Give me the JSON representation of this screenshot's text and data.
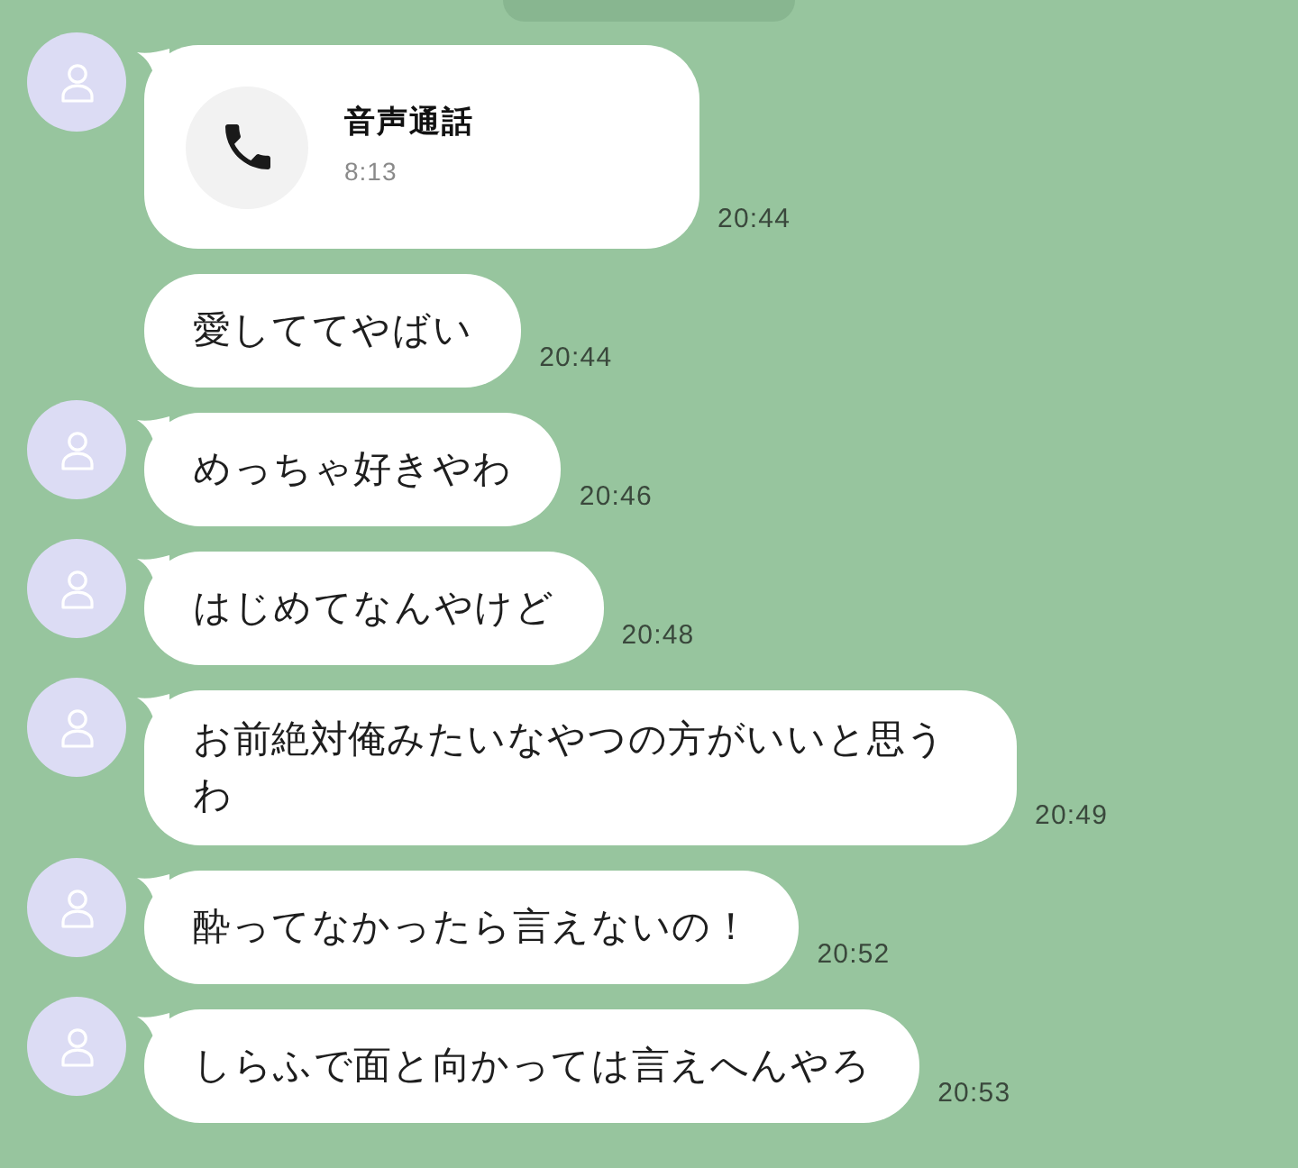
{
  "messages": [
    {
      "kind": "call",
      "avatar": true,
      "title": "音声通話",
      "duration": "8:13",
      "time": "20:44"
    },
    {
      "kind": "text",
      "avatar": false,
      "text": "愛しててやばい",
      "time": "20:44"
    },
    {
      "kind": "text",
      "avatar": true,
      "text": "めっちゃ好きやわ",
      "time": "20:46"
    },
    {
      "kind": "text",
      "avatar": true,
      "text": "はじめてなんやけど",
      "time": "20:48"
    },
    {
      "kind": "text",
      "avatar": true,
      "text": "お前絶対俺みたいなやつの方がいいと思うわ",
      "time": "20:49"
    },
    {
      "kind": "text",
      "avatar": true,
      "text": "酔ってなかったら言えないの！",
      "time": "20:52"
    },
    {
      "kind": "text",
      "avatar": true,
      "text": "しらふで面と向かっては言えへんやろ",
      "time": "20:53"
    }
  ]
}
